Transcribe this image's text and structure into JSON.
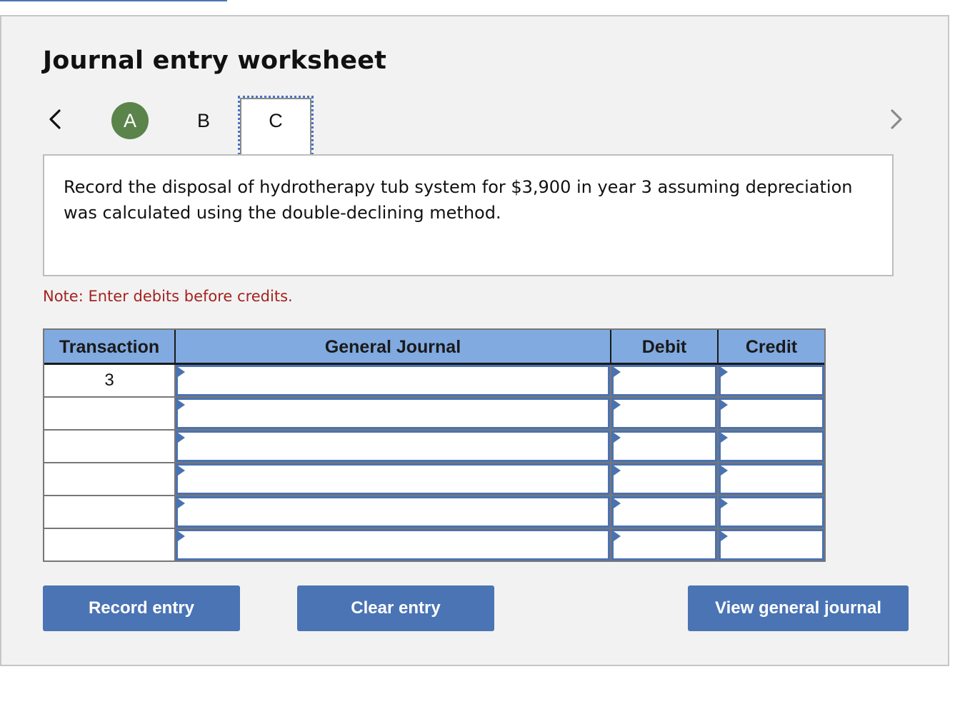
{
  "worksheet": {
    "title": "Journal entry worksheet",
    "nav": {
      "prev_icon": "chevron-left-icon",
      "next_icon": "chevron-right-icon",
      "tabs": [
        {
          "label": "A",
          "state": "completed"
        },
        {
          "label": "B",
          "state": "default"
        },
        {
          "label": "C",
          "state": "active"
        }
      ]
    },
    "question": "Record the disposal of hydrotherapy tub system for $3,900 in year 3 assuming depreciation was calculated using the double-declining method.",
    "note": "Note: Enter debits before credits.",
    "colors": {
      "completed_tab": "#5a8449",
      "header_bg": "#80aae0",
      "button_bg": "#4a74b4",
      "note_text": "#a3231f"
    }
  },
  "table": {
    "headers": [
      "Transaction",
      "General Journal",
      "Debit",
      "Credit"
    ],
    "rows": [
      {
        "transaction": "3",
        "general_journal": "",
        "debit": "",
        "credit": ""
      },
      {
        "transaction": "",
        "general_journal": "",
        "debit": "",
        "credit": ""
      },
      {
        "transaction": "",
        "general_journal": "",
        "debit": "",
        "credit": ""
      },
      {
        "transaction": "",
        "general_journal": "",
        "debit": "",
        "credit": ""
      },
      {
        "transaction": "",
        "general_journal": "",
        "debit": "",
        "credit": ""
      },
      {
        "transaction": "",
        "general_journal": "",
        "debit": "",
        "credit": ""
      }
    ]
  },
  "buttons": {
    "record": "Record entry",
    "clear": "Clear entry",
    "view": "View general journal"
  }
}
